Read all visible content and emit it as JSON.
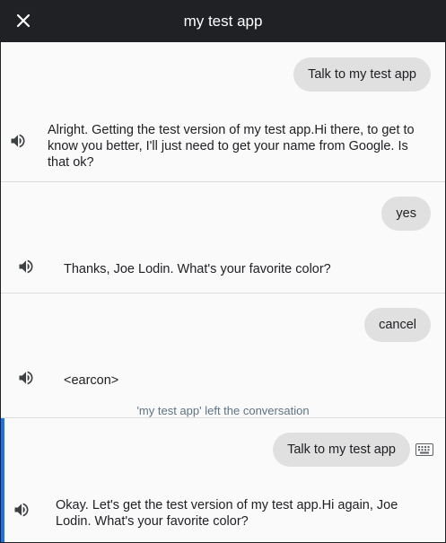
{
  "header": {
    "title": "my test app",
    "close_icon": "close-icon"
  },
  "turns": [
    {
      "user": "Talk to my test app",
      "response": "Alright. Getting the test version of my test app.Hi there, to get to know you better, I'll just need to get your name from Google. Is that ok?"
    },
    {
      "user": "yes",
      "response": "Thanks, Joe Lodin. What's your favorite color?"
    },
    {
      "user": "cancel",
      "response": "<earcon>",
      "note": "'my test app' left the conversation"
    },
    {
      "user": "Talk to my test app",
      "response": "Okay. Let's get the test version of my test app.Hi again, Joe Lodin. What's your favorite color?"
    }
  ],
  "colors": {
    "header_bg": "#202124",
    "bubble_bg": "#e0e0e0",
    "accent": "#1a73e8"
  }
}
